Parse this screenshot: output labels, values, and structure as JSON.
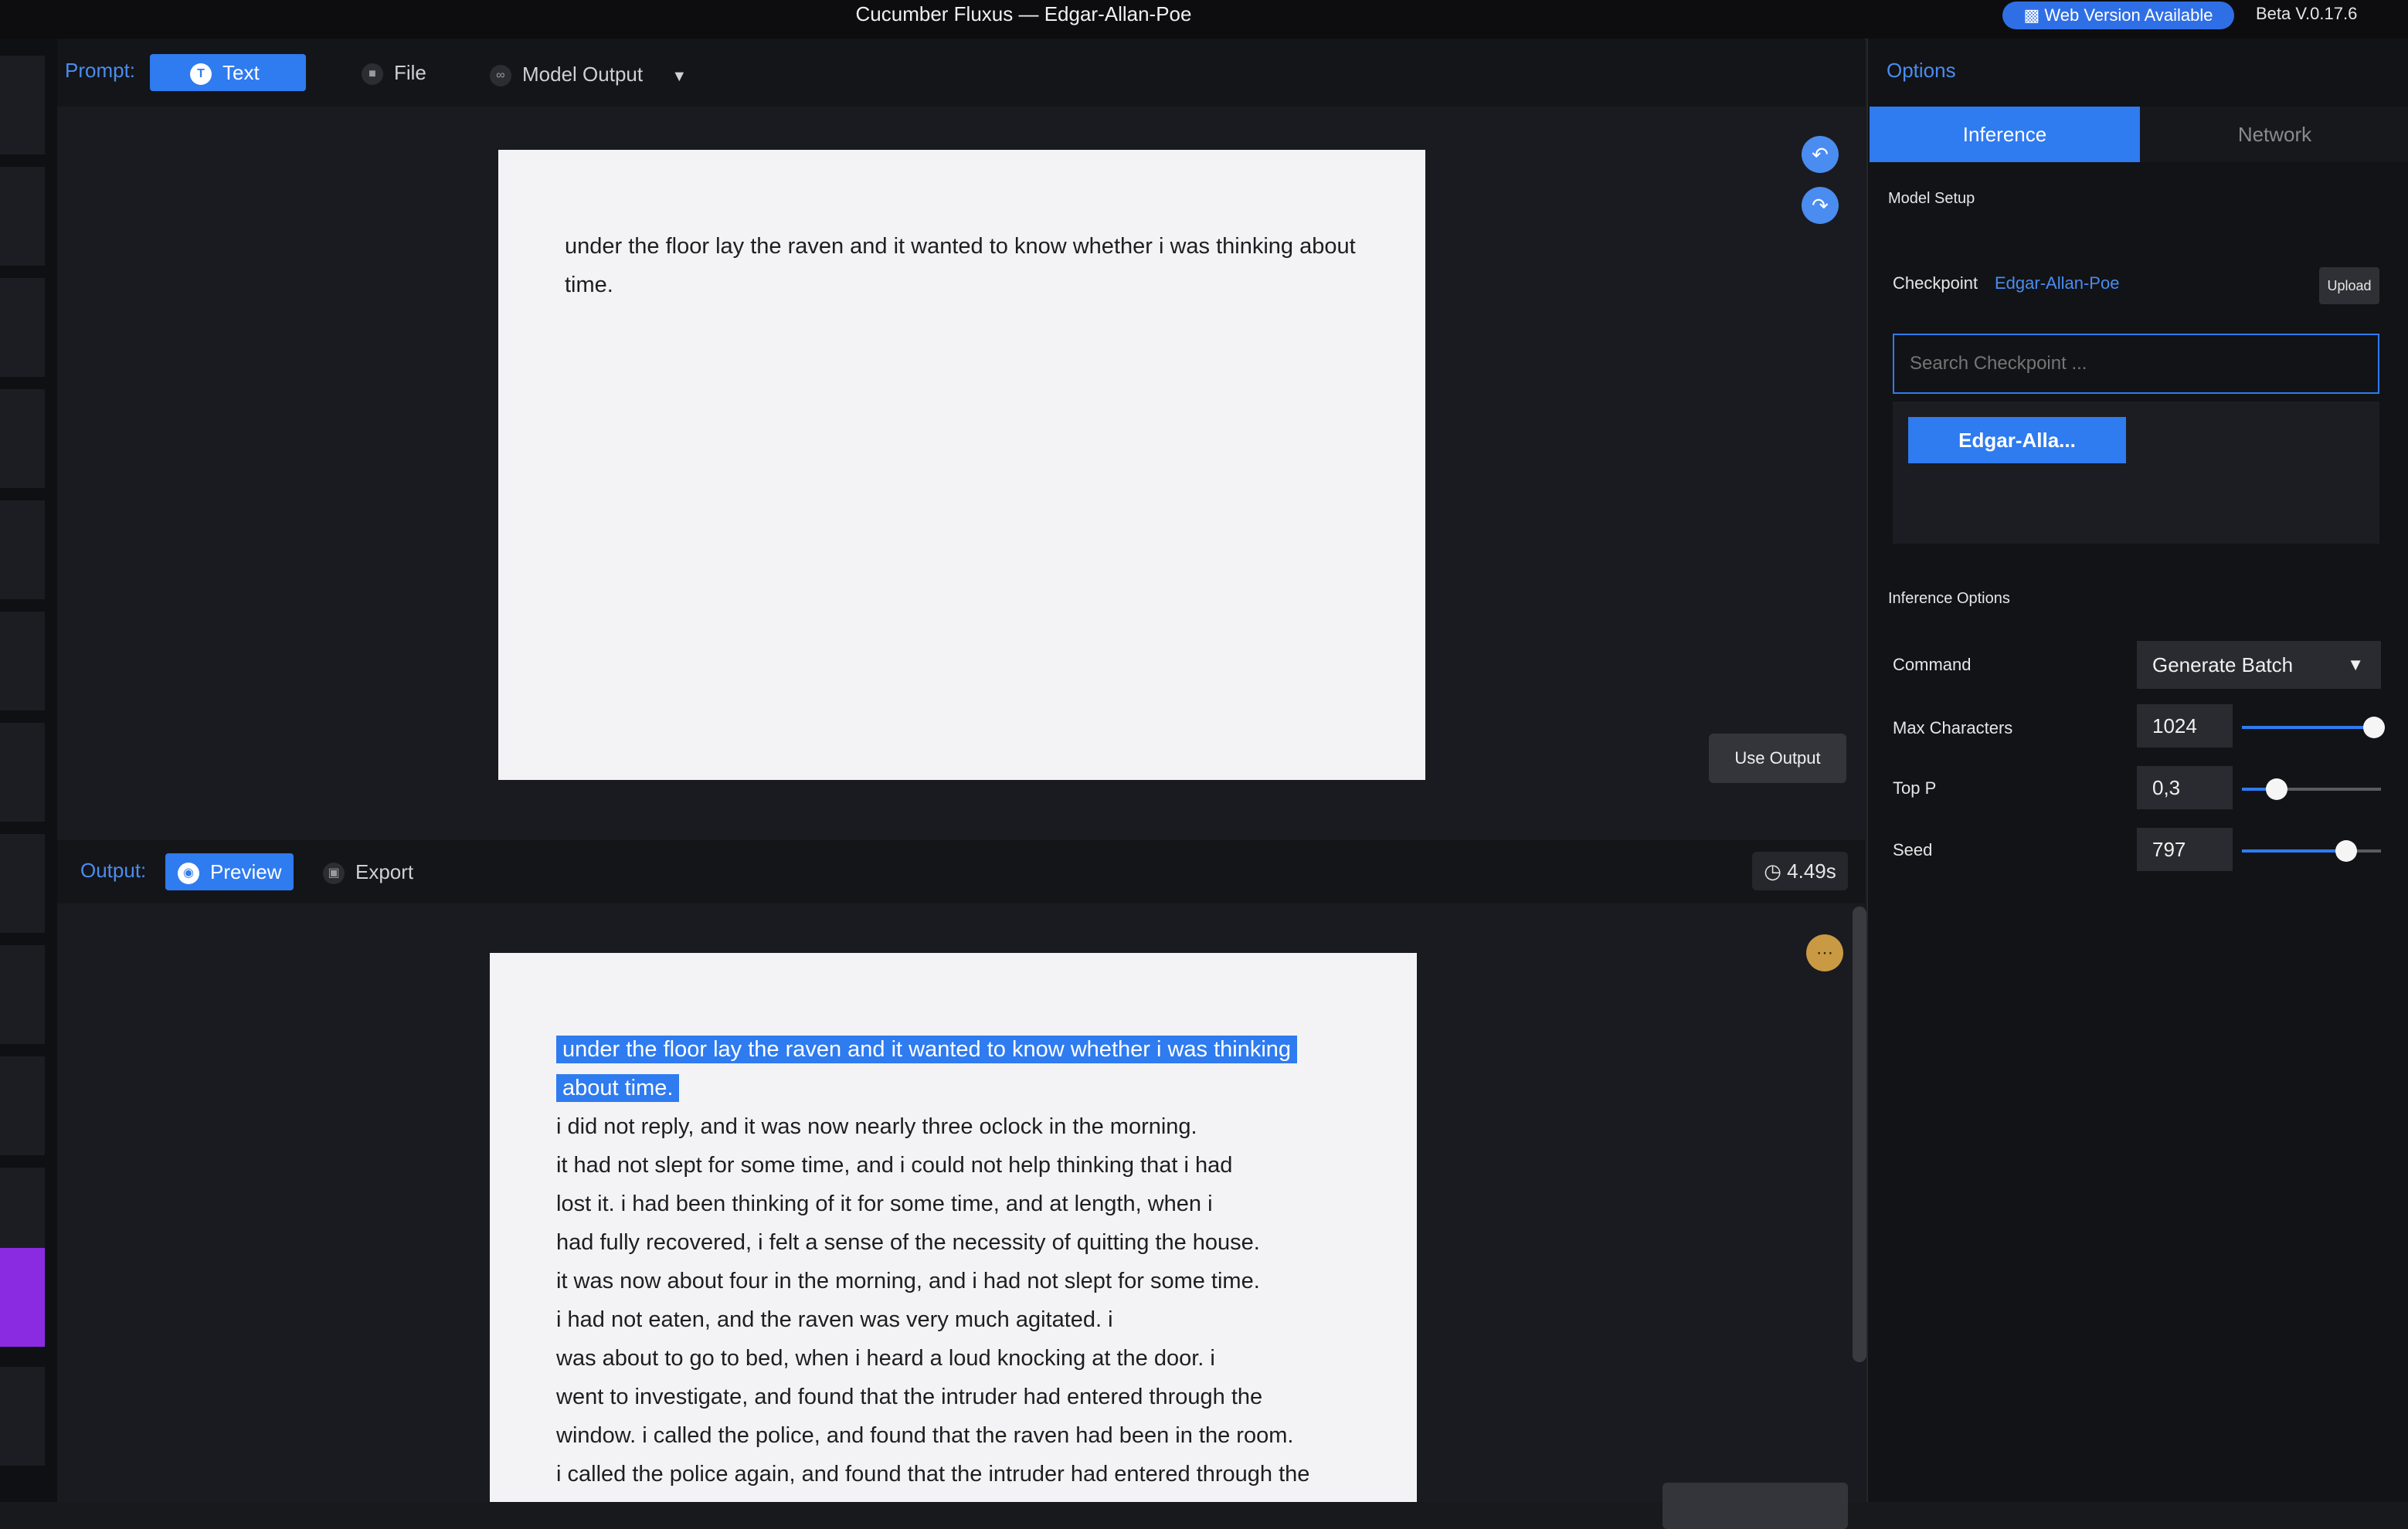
{
  "window": {
    "title": "Cucumber Fluxus — Edgar-Allan-Poe",
    "web_badge": "Web Version Available",
    "version": "Beta V.0.17.6"
  },
  "prompt": {
    "label": "Prompt:",
    "tabs": [
      {
        "label": "Text",
        "icon": "text-icon",
        "active": true
      },
      {
        "label": "File",
        "icon": "file-icon",
        "active": false
      },
      {
        "label": "Model Output",
        "icon": "link-icon",
        "active": false
      }
    ],
    "text": "under the floor lay the raven and it wanted to know whether i was thinking about time.",
    "use_output": "Use Output"
  },
  "output": {
    "label": "Output:",
    "tabs": [
      {
        "label": "Preview",
        "icon": "eye-icon",
        "active": true
      },
      {
        "label": "Export",
        "icon": "export-icon",
        "active": false
      }
    ],
    "time": "4.49s",
    "highlight_lines": [
      "under the floor lay the raven and it wanted to know whether i was thinking",
      "about time."
    ],
    "lines": [
      "i did not reply, and it was now nearly three oclock in the morning.",
      "it had not slept for some time, and i could not help thinking that i had",
      "lost it. i had been thinking of it for some time, and at length, when i",
      "had fully recovered, i felt a sense of the necessity of quitting the house.",
      "it was now about four in the morning, and i had not slept for some time.",
      "i had not eaten, and the raven was very much agitated. i",
      "was about to go to bed, when i heard a loud knocking at the door. i",
      "went to investigate, and found that the intruder had entered through the",
      "window. i called the police, and found that the raven had been in the room.",
      "i called the police again, and found that the intruder had entered through the"
    ]
  },
  "options": {
    "title": "Options",
    "tabs": [
      {
        "label": "Inference",
        "active": true
      },
      {
        "label": "Network",
        "active": false
      }
    ],
    "model_setup": "Model Setup",
    "checkpoint_label": "Checkpoint",
    "checkpoint_value": "Edgar-Allan-Poe",
    "upload": "Upload",
    "search_placeholder": "Search Checkpoint ...",
    "checkpoint_result": "Edgar-Alla...",
    "inference_options": "Inference Options",
    "command_label": "Command",
    "command_value": "Generate Batch",
    "max_chars_label": "Max Characters",
    "max_chars_value": "1024",
    "max_chars_level": 0.95,
    "top_p_label": "Top P",
    "top_p_value": "0,3",
    "top_p_level": 0.25,
    "seed_label": "Seed",
    "seed_value": "797",
    "seed_level": 0.75
  },
  "colors": {
    "accent": "#2f7bf0",
    "rail_active": "#8a2be2"
  }
}
